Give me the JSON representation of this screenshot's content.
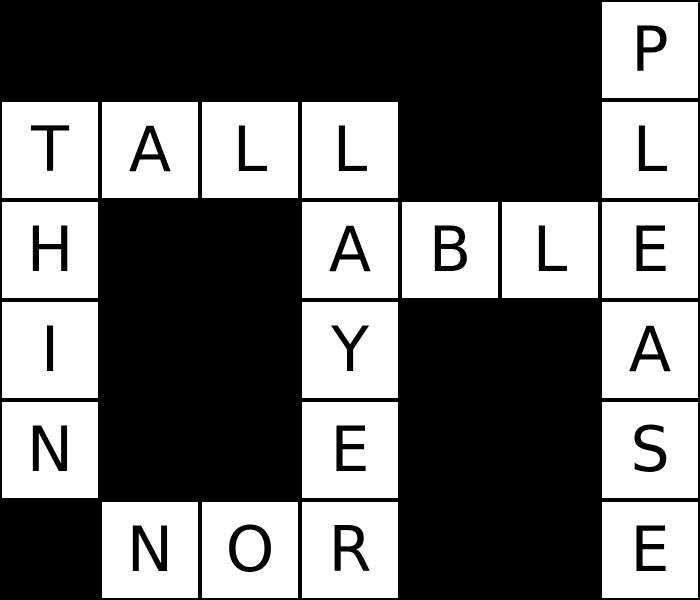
{
  "puzzle": {
    "rows": 6,
    "cols": 7,
    "colors": {
      "block": "#000000",
      "cell": "#ffffff",
      "letter": "#000000"
    },
    "letters": [
      [
        "",
        "",
        "",
        "",
        "",
        "",
        "P"
      ],
      [
        "T",
        "A",
        "L",
        "L",
        "",
        "",
        "L"
      ],
      [
        "H",
        "",
        "",
        "A",
        "B",
        "L",
        "E"
      ],
      [
        "I",
        "",
        "",
        "Y",
        "",
        "",
        "A"
      ],
      [
        "N",
        "",
        "",
        "E",
        "",
        "",
        "S"
      ],
      [
        "",
        "N",
        "O",
        "R",
        "",
        "",
        "E"
      ]
    ]
  }
}
